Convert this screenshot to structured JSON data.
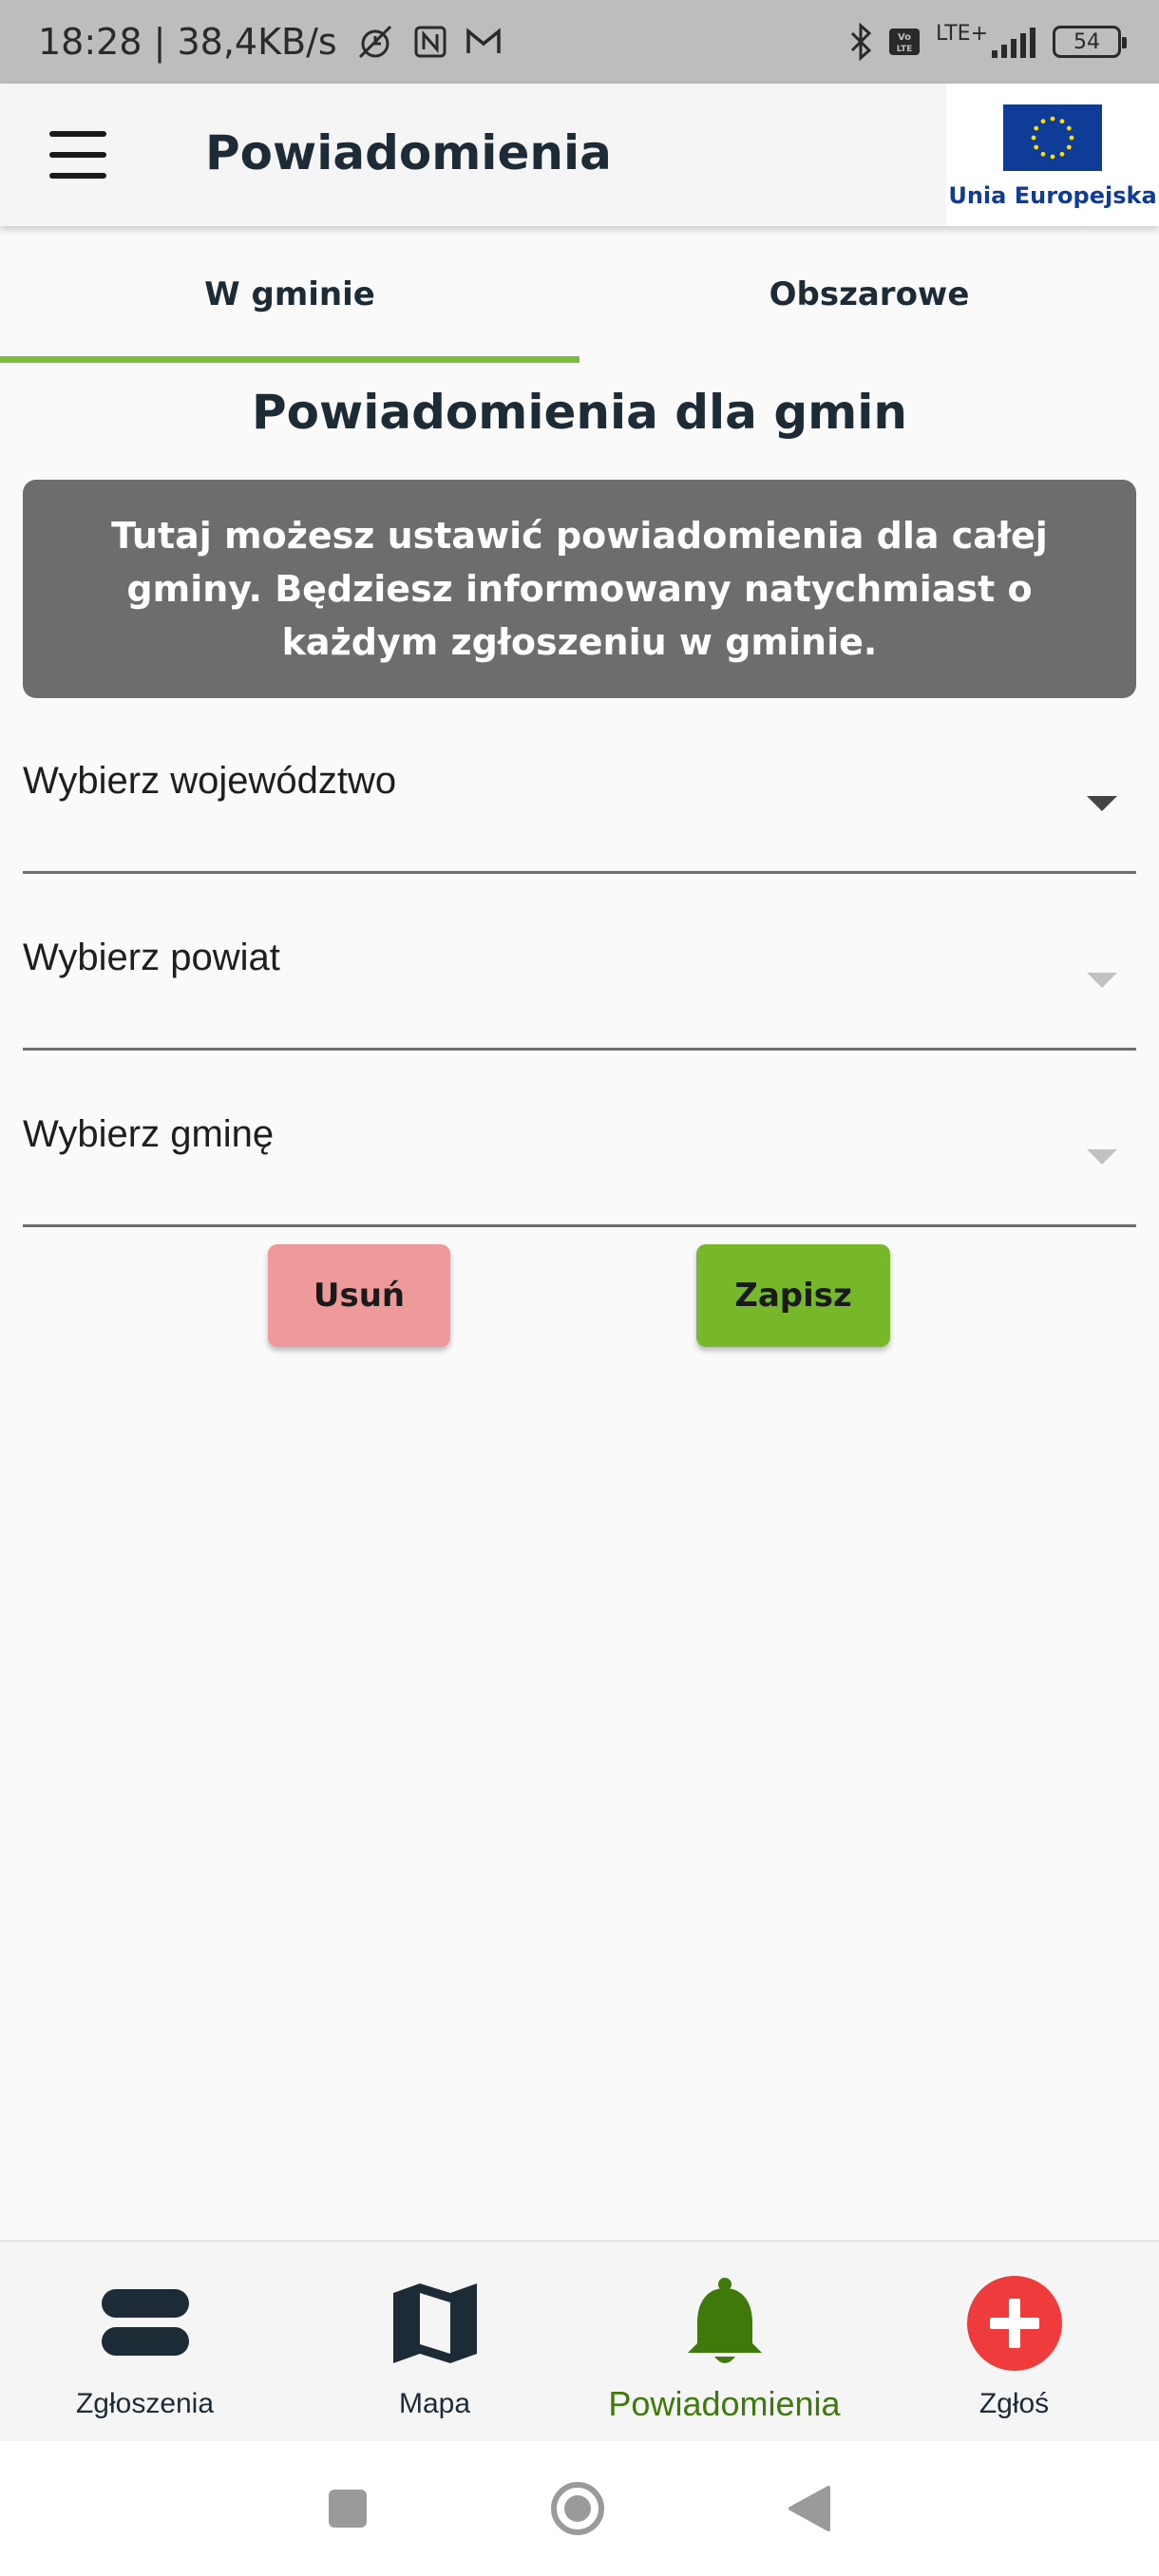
{
  "status_bar": {
    "time_speed": "18:28 | 38,4KB/s",
    "network": "LTE+",
    "volte": "Vo LTE",
    "battery": "54"
  },
  "app_bar": {
    "title": "Powiadomienia",
    "eu_label": "Unia Europejska"
  },
  "tabs": [
    {
      "label": "W gminie",
      "active": true
    },
    {
      "label": "Obszarowe",
      "active": false
    }
  ],
  "section_title": "Powiadomienia dla gmin",
  "info_text": "Tutaj możesz ustawić powiadomienia dla całej gminy. Będziesz informowany natychmiast o każdym zgłoszeniu w gminie.",
  "dropdowns": [
    {
      "placeholder": "Wybierz województwo",
      "enabled": true
    },
    {
      "placeholder": "Wybierz powiat",
      "enabled": false
    },
    {
      "placeholder": "Wybierz gminę",
      "enabled": false
    }
  ],
  "buttons": {
    "delete_label": "Usuń",
    "save_label": "Zapisz"
  },
  "bottom_nav": [
    {
      "label": "Zgłoszenia",
      "icon": "reports-icon",
      "active": false
    },
    {
      "label": "Mapa",
      "icon": "map-icon",
      "active": false
    },
    {
      "label": "Powiadomienia",
      "icon": "bell-icon",
      "active": true
    },
    {
      "label": "Zgłoś",
      "icon": "add-report-icon",
      "active": false
    }
  ],
  "colors": {
    "accent_green": "#7cbd3a",
    "active_nav": "#3e7a0a",
    "save_button": "#76b82a",
    "delete_button": "#ef9a9a",
    "report_button": "#ef3b3b",
    "info_box": "#6d6d6d",
    "eu_blue": "#0f3c97"
  }
}
